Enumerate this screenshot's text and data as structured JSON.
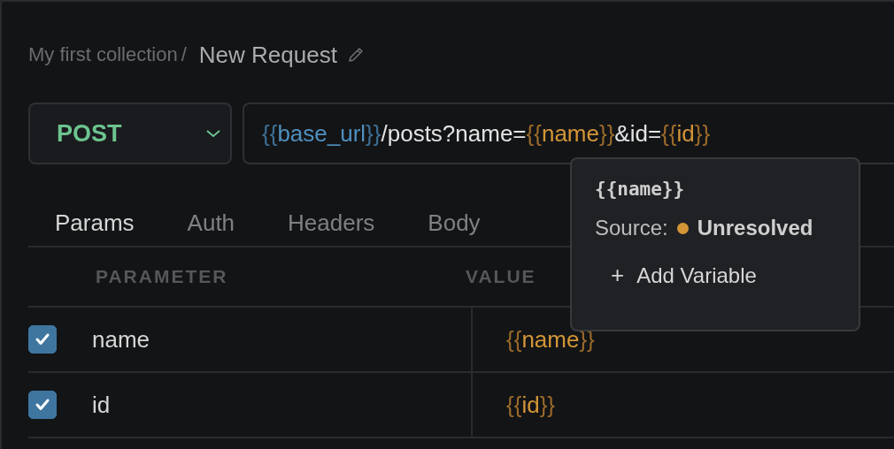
{
  "breadcrumb": {
    "collection": "My first collection",
    "separator": "/",
    "request": "New Request"
  },
  "method": {
    "label": "POST"
  },
  "url": [
    {
      "kind": "brace",
      "text": "{{",
      "resolved": true
    },
    {
      "kind": "var",
      "text": "base_url",
      "resolved": true
    },
    {
      "kind": "brace",
      "text": "}}",
      "resolved": true
    },
    {
      "kind": "text",
      "text": "/posts?name="
    },
    {
      "kind": "brace",
      "text": "{{",
      "resolved": false
    },
    {
      "kind": "var",
      "text": "name",
      "resolved": false
    },
    {
      "kind": "brace",
      "text": "}}",
      "resolved": false
    },
    {
      "kind": "text",
      "text": "&id="
    },
    {
      "kind": "brace",
      "text": "{{",
      "resolved": false
    },
    {
      "kind": "var",
      "text": "id",
      "resolved": false
    },
    {
      "kind": "brace",
      "text": "}}",
      "resolved": false
    }
  ],
  "tabs": [
    {
      "label": "Params",
      "selected": true
    },
    {
      "label": "Auth",
      "selected": false
    },
    {
      "label": "Headers",
      "selected": false
    },
    {
      "label": "Body",
      "selected": false
    }
  ],
  "table": {
    "columns": [
      "PARAMETER",
      "VALUE"
    ],
    "rows": [
      {
        "checked": true,
        "parameter": "name",
        "value": [
          {
            "kind": "brace",
            "text": "{{",
            "resolved": false
          },
          {
            "kind": "var",
            "text": "name",
            "resolved": false
          },
          {
            "kind": "brace",
            "text": "}}",
            "resolved": false
          }
        ]
      },
      {
        "checked": true,
        "parameter": "id",
        "value": [
          {
            "kind": "brace",
            "text": "{{",
            "resolved": false
          },
          {
            "kind": "var",
            "text": "id",
            "resolved": false
          },
          {
            "kind": "brace",
            "text": "}}",
            "resolved": false
          }
        ]
      }
    ]
  },
  "tooltip": {
    "variable": "{{name}}",
    "source_label": "Source:",
    "source": "Unresolved",
    "resolved": false,
    "action_icon": "+",
    "action": "Add Variable"
  }
}
